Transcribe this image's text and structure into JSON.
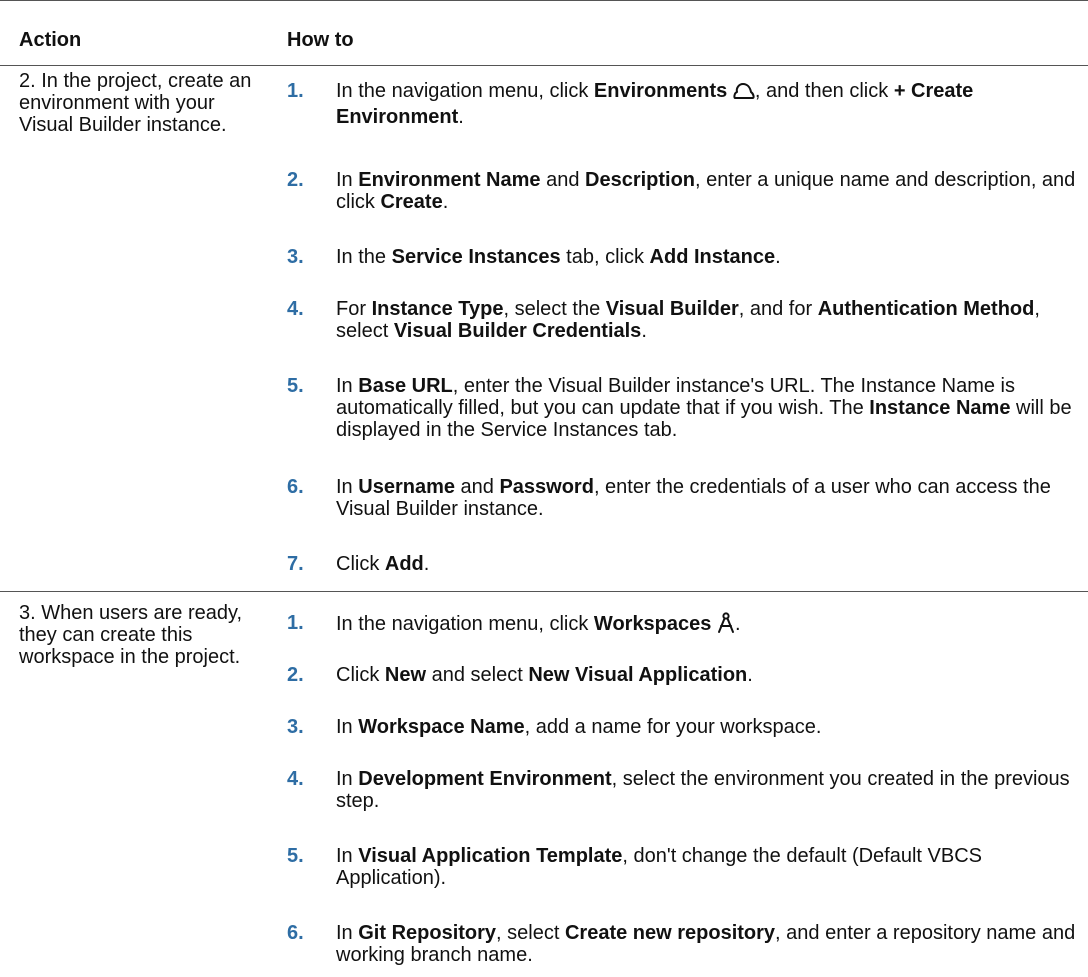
{
  "header": {
    "action": "Action",
    "how_to": "How to"
  },
  "rows": [
    {
      "action": "2. In the project, create an environment with your Visual Builder instance.",
      "steps": [
        {
          "num": "1.",
          "parts": [
            "In the navigation menu, click ",
            "Environments",
            ", and then click ",
            "+ Create Environment",
            "."
          ]
        },
        {
          "num": "2.",
          "parts": [
            "In ",
            "Environment Name",
            " and ",
            "Description",
            ", enter a unique name and description, and click ",
            "Create",
            "."
          ]
        },
        {
          "num": "3.",
          "parts": [
            "In the ",
            "Service Instances",
            " tab, click ",
            "Add Instance",
            "."
          ]
        },
        {
          "num": "4.",
          "parts": [
            "For ",
            "Instance Type",
            ", select the ",
            "Visual Builder",
            ", and for ",
            "Authentication Method",
            ", select ",
            "Visual Builder Credentials",
            "."
          ]
        },
        {
          "num": "5.",
          "parts": [
            "In ",
            "Base URL",
            ", enter the Visual Builder instance's URL. The Instance Name is automatically filled, but you can update that if you wish. The ",
            "Instance Name",
            " will be displayed in the Service Instances tab."
          ]
        },
        {
          "num": "6.",
          "parts": [
            "In ",
            "Username",
            " and ",
            "Password",
            ", enter the credentials of a user who can access the Visual Builder instance."
          ]
        },
        {
          "num": "7.",
          "parts": [
            "Click ",
            "Add",
            "."
          ]
        }
      ]
    },
    {
      "action": "3. When users are ready, they can create this workspace in the project.",
      "steps": [
        {
          "num": "1.",
          "parts": [
            "In the navigation menu, click ",
            "Workspaces",
            "."
          ]
        },
        {
          "num": "2.",
          "parts": [
            "Click ",
            "New",
            " and select ",
            "New Visual Application",
            "."
          ]
        },
        {
          "num": "3.",
          "parts": [
            "In ",
            "Workspace Name",
            ", add a name for your workspace."
          ]
        },
        {
          "num": "4.",
          "parts": [
            "In ",
            "Development Environment",
            ", select the environment you created in the previous step."
          ]
        },
        {
          "num": "5.",
          "parts": [
            "In ",
            "Visual Application Template",
            ", don't change the default (Default VBCS Application)."
          ]
        },
        {
          "num": "6.",
          "parts": [
            "In ",
            "Git Repository",
            ", select ",
            "Create new repository",
            ", and enter a repository name and working branch name."
          ]
        }
      ]
    }
  ],
  "icons": {
    "environments": "cloud-icon",
    "workspaces": "compass-icon"
  },
  "colors": {
    "step_number": "#2e6da4",
    "rule": "#555555"
  }
}
